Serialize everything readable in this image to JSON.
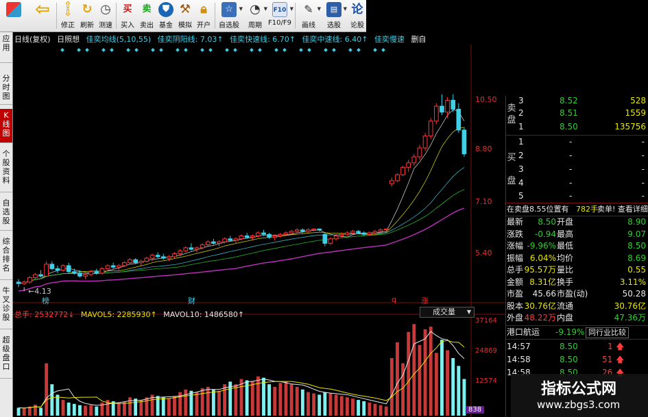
{
  "toolbar": {
    "buttons": [
      {
        "label": "",
        "icon": "grid-icon"
      },
      {
        "label": "",
        "icon": "back-arrow-icon"
      },
      {
        "label": "修正",
        "icon": "up-arrow-icon"
      },
      {
        "label": "刷新",
        "icon": "refresh-icon"
      },
      {
        "label": "测速",
        "icon": "clock-icon"
      },
      {
        "label": "买入",
        "icon": "buy-icon",
        "glyph": "买"
      },
      {
        "label": "卖出",
        "icon": "sell-icon",
        "glyph": "卖"
      },
      {
        "label": "基金",
        "icon": "shield-icon"
      },
      {
        "label": "模拟",
        "icon": "hammer-icon"
      },
      {
        "label": "开户",
        "icon": "lock-icon"
      },
      {
        "label": "自选股",
        "icon": "star-icon"
      },
      {
        "label": "周期",
        "icon": "period-icon"
      },
      {
        "label": "F10/F9",
        "icon": "f10-icon"
      },
      {
        "label": "画线",
        "icon": "pencil-icon"
      },
      {
        "label": "选股",
        "icon": "monitor-icon"
      },
      {
        "label": "论股",
        "icon": "forum-icon",
        "glyph": "论"
      }
    ]
  },
  "lefttabs": [
    "应用",
    "分时图",
    "K线图",
    "个股资料",
    "自选股",
    "综合排名",
    "牛叉诊股",
    "超级盘口"
  ],
  "indicators": {
    "items": [
      {
        "text": "日线(复权)",
        "color": "#e8e8e8"
      },
      {
        "text": "日照想",
        "color": "#e8e8e8"
      },
      {
        "text": "佳奕均线(5,10,55)",
        "color": "#3fd0e8"
      },
      {
        "text": "佳奕阴阳线: 7.03↑",
        "color": "#3fd0e8"
      },
      {
        "text": "佳奕快速线: 6.70↑",
        "color": "#3fd0e8"
      },
      {
        "text": "佳奕中速线: 6.40↑",
        "color": "#3fd0e8"
      },
      {
        "text": "佳奕慢速",
        "color": "#3fd0e8"
      },
      {
        "text": "删自",
        "color": "#e8e8e8"
      }
    ]
  },
  "price_axis": [
    "10.50",
    "8.80",
    "7.10",
    "5.40"
  ],
  "low_marker": "4.13",
  "events": [
    "榜",
    "财",
    "q",
    "涨"
  ],
  "volume": {
    "legend_total": "总手: 2532772↓",
    "mavol5": "MAVOL5: 2285930↑",
    "mavol10": "MAVOL10: 1486580↑",
    "select": "成交量",
    "axis": [
      "37164",
      "24869",
      "12574",
      "838"
    ]
  },
  "chart_data": {
    "type": "candlestick",
    "price_axis_labels": [
      10.5,
      8.8,
      7.1,
      5.4
    ],
    "volume_axis_labels": [
      37164,
      24869,
      12574,
      838
    ],
    "low_marker": 4.13,
    "candles": [
      [
        4.3,
        4.4,
        4.13,
        4.25
      ],
      [
        4.25,
        4.35,
        4.2,
        4.3
      ],
      [
        4.3,
        4.5,
        4.25,
        4.45
      ],
      [
        4.45,
        4.6,
        4.4,
        4.55
      ],
      [
        4.55,
        4.7,
        4.45,
        4.5
      ],
      [
        4.5,
        5.0,
        4.5,
        4.9
      ],
      [
        4.9,
        5.0,
        4.7,
        4.75
      ],
      [
        4.75,
        4.85,
        4.6,
        4.7
      ],
      [
        4.7,
        4.9,
        4.65,
        4.85
      ],
      [
        4.85,
        4.95,
        4.6,
        4.65
      ],
      [
        4.65,
        4.75,
        4.55,
        4.6
      ],
      [
        4.6,
        4.7,
        4.45,
        4.5
      ],
      [
        4.5,
        4.6,
        4.4,
        4.55
      ],
      [
        4.55,
        4.7,
        4.5,
        4.65
      ],
      [
        4.65,
        4.75,
        4.55,
        4.6
      ],
      [
        4.6,
        4.8,
        4.55,
        4.75
      ],
      [
        4.75,
        4.9,
        4.7,
        4.85
      ],
      [
        4.85,
        4.95,
        4.75,
        4.8
      ],
      [
        4.8,
        4.9,
        4.7,
        4.85
      ],
      [
        4.85,
        5.0,
        4.8,
        4.95
      ],
      [
        4.95,
        5.1,
        4.9,
        5.05
      ],
      [
        5.05,
        5.1,
        4.9,
        4.95
      ],
      [
        4.95,
        5.05,
        4.85,
        5.0
      ],
      [
        5.0,
        5.15,
        4.95,
        5.1
      ],
      [
        5.1,
        5.25,
        5.0,
        5.2
      ],
      [
        5.2,
        5.3,
        5.1,
        5.15
      ],
      [
        5.15,
        5.25,
        5.05,
        5.1
      ],
      [
        5.1,
        5.2,
        5.0,
        5.15
      ],
      [
        5.15,
        5.3,
        5.1,
        5.25
      ],
      [
        5.25,
        5.4,
        5.2,
        5.35
      ],
      [
        5.35,
        5.5,
        5.3,
        5.45
      ],
      [
        5.45,
        5.6,
        5.35,
        5.4
      ],
      [
        5.4,
        5.5,
        5.3,
        5.45
      ],
      [
        5.45,
        5.6,
        5.4,
        5.55
      ],
      [
        5.55,
        5.7,
        5.5,
        5.65
      ],
      [
        5.65,
        5.75,
        5.55,
        5.6
      ],
      [
        5.6,
        5.7,
        5.5,
        5.65
      ],
      [
        5.65,
        5.8,
        5.6,
        5.75
      ],
      [
        5.75,
        5.85,
        5.65,
        5.7
      ],
      [
        5.7,
        5.8,
        5.6,
        5.75
      ],
      [
        5.75,
        5.9,
        5.7,
        5.85
      ],
      [
        5.85,
        5.95,
        5.75,
        5.8
      ],
      [
        5.8,
        5.9,
        5.7,
        5.85
      ],
      [
        5.85,
        6.0,
        5.8,
        5.95
      ],
      [
        5.95,
        6.05,
        5.85,
        5.9
      ],
      [
        5.9,
        5.95,
        5.75,
        5.8
      ],
      [
        5.8,
        5.9,
        5.7,
        5.85
      ],
      [
        5.85,
        5.95,
        5.8,
        5.9
      ],
      [
        5.9,
        6.0,
        5.85,
        5.95
      ],
      [
        5.95,
        6.05,
        5.9,
        6.0
      ],
      [
        6.0,
        6.1,
        5.95,
        6.05
      ],
      [
        6.05,
        6.1,
        5.95,
        6.0
      ],
      [
        6.0,
        6.1,
        5.95,
        6.05
      ],
      [
        6.05,
        6.1,
        6.0,
        6.08
      ],
      [
        6.08,
        6.1,
        6.0,
        6.05
      ],
      [
        5.9,
        5.95,
        5.5,
        5.6
      ],
      [
        5.6,
        5.8,
        5.55,
        5.75
      ],
      [
        5.75,
        5.9,
        5.7,
        5.85
      ],
      [
        5.85,
        5.95,
        5.8,
        5.9
      ],
      [
        5.9,
        6.0,
        5.85,
        5.95
      ],
      [
        5.95,
        6.05,
        5.9,
        6.0
      ],
      [
        6.0,
        6.05,
        5.9,
        5.95
      ],
      [
        5.95,
        6.0,
        5.85,
        5.9
      ],
      [
        5.9,
        6.0,
        5.85,
        5.95
      ],
      [
        5.95,
        6.05,
        5.9,
        6.0
      ],
      [
        6.0,
        6.1,
        5.95,
        6.05
      ],
      [
        6.05,
        6.1,
        6.0,
        6.08
      ],
      [
        7.6,
        7.8,
        7.5,
        7.7
      ],
      [
        7.7,
        7.95,
        7.65,
        7.9
      ],
      [
        7.9,
        8.2,
        7.85,
        8.15
      ],
      [
        8.15,
        8.4,
        8.0,
        8.3
      ],
      [
        8.3,
        8.6,
        8.2,
        8.5
      ],
      [
        8.5,
        8.9,
        8.4,
        8.8
      ],
      [
        8.8,
        9.3,
        8.7,
        9.2
      ],
      [
        9.2,
        9.8,
        9.1,
        9.7
      ],
      [
        9.7,
        10.3,
        9.6,
        10.2
      ],
      [
        10.2,
        10.6,
        9.9,
        10.0
      ],
      [
        10.0,
        10.5,
        9.8,
        10.4
      ],
      [
        10.4,
        10.6,
        10.0,
        10.1
      ],
      [
        10.1,
        10.3,
        9.3,
        9.4
      ],
      [
        9.4,
        9.5,
        8.5,
        8.6
      ]
    ],
    "volume": [
      3000,
      2800,
      3500,
      4200,
      3000,
      20000,
      12000,
      8000,
      6000,
      5000,
      4500,
      4000,
      3800,
      4000,
      3500,
      5000,
      6000,
      5500,
      4800,
      5200,
      7000,
      6500,
      6000,
      7000,
      8000,
      7500,
      7000,
      6500,
      7500,
      9000,
      10000,
      9500,
      9000,
      10500,
      11000,
      10000,
      9500,
      12000,
      13000,
      12000,
      14000,
      13500,
      13000,
      15000,
      14500,
      12000,
      11000,
      12500,
      13000,
      12000,
      11000,
      10000,
      9000,
      8500,
      8000,
      9000,
      8500,
      8000,
      7500,
      7000,
      6500,
      6000,
      5500,
      5000,
      4500,
      4000,
      3500,
      22000,
      28000,
      20000,
      32000,
      35000,
      27000,
      33000,
      34000,
      24000,
      29000,
      25000,
      22000,
      19000,
      14000
    ],
    "volume_colors": "red=up, cyan=down"
  },
  "panel": {
    "sell_side_label": "卖盘",
    "sell_rows": [
      {
        "n": "3",
        "price": "8.52",
        "vol": "528"
      },
      {
        "n": "2",
        "price": "8.51",
        "vol": "1559"
      },
      {
        "n": "1",
        "price": "8.50",
        "vol": "135756"
      }
    ],
    "buy_side_label": "买盘",
    "buy_rows": [
      {
        "n": "1",
        "price": "-",
        "vol": "-"
      },
      {
        "n": "2",
        "price": "-",
        "vol": "-"
      },
      {
        "n": "3",
        "price": "-",
        "vol": "-"
      },
      {
        "n": "4",
        "price": "-",
        "vol": "-"
      },
      {
        "n": "5",
        "price": "-",
        "vol": "-"
      }
    ],
    "order_line": {
      "left": "在卖盘8.55位置有",
      "vol": "782手",
      "link": "卖单! 查看详细"
    },
    "stats": [
      {
        "k1": "最新",
        "v1": "8.50",
        "c1": "green",
        "k2": "开盘",
        "v2": "8.90",
        "c2": "green"
      },
      {
        "k1": "涨跌",
        "v1": "-0.94",
        "c1": "green",
        "k2": "最高",
        "v2": "9.07",
        "c2": "green"
      },
      {
        "k1": "涨幅",
        "v1": "-9.96%",
        "c1": "green",
        "k2": "最低",
        "v2": "8.50",
        "c2": "green"
      },
      {
        "k1": "振幅",
        "v1": "6.04%",
        "c1": "yellow",
        "k2": "均价",
        "v2": "8.69",
        "c2": "green"
      },
      {
        "k1": "总手",
        "v1": "95.57万",
        "c1": "yellow",
        "k2": "量比",
        "v2": "0.55",
        "c2": "yellow"
      },
      {
        "k1": "金额",
        "v1": "8.31亿",
        "c1": "yellow",
        "k2": "换手",
        "v2": "3.11%",
        "c2": "yellow"
      },
      {
        "k1": "市盈",
        "v1": "45.66",
        "c1": "white",
        "k2": "市盈(动)",
        "v2": "50.28",
        "c2": "white"
      },
      {
        "k1": "股本",
        "v1": "30.76亿",
        "c1": "yellow",
        "k2": "流通",
        "v2": "30.76亿",
        "c2": "yellow"
      },
      {
        "k1": "外盘",
        "v1": "48.22万",
        "c1": "red",
        "k2": "内盘",
        "v2": "47.36万",
        "c2": "green"
      }
    ],
    "sector": {
      "name": "港口航运",
      "pct": "-9.19%",
      "button": "同行业比较"
    },
    "ticks": [
      {
        "time": "14:57",
        "price": "8.50",
        "vol": "1"
      },
      {
        "time": "14:58",
        "price": "8.50",
        "vol": "51"
      },
      {
        "time": "14:58",
        "price": "8.50",
        "vol": "26"
      }
    ]
  },
  "watermark": {
    "line1": "指标公式网",
    "line2": "www.zbgs3.com"
  }
}
